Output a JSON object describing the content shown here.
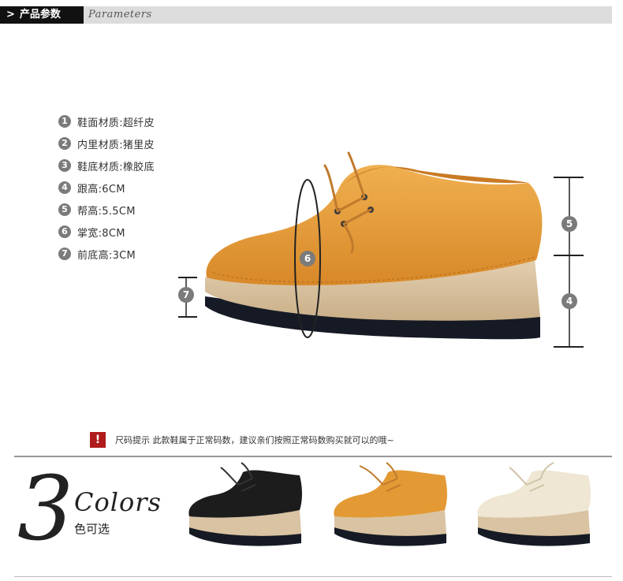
{
  "header": {
    "chevron": ">",
    "title_cn": "产品参数",
    "title_en": "Parameters"
  },
  "specs": [
    {
      "num": "1",
      "text": "鞋面材质:超纤皮"
    },
    {
      "num": "2",
      "text": "内里材质:猪里皮"
    },
    {
      "num": "3",
      "text": "鞋底材质:橡胶底"
    },
    {
      "num": "4",
      "text": "跟高:6CM"
    },
    {
      "num": "5",
      "text": "帮高:5.5CM"
    },
    {
      "num": "6",
      "text": "掌宽:8CM"
    },
    {
      "num": "7",
      "text": "前底高:3CM"
    }
  ],
  "diagram_markers": {
    "m4": "4",
    "m5": "5",
    "m6": "6",
    "m7": "7"
  },
  "notice": {
    "icon": "!",
    "text": "尺码提示 此款鞋属于正常码数，建议亲们按照正常码数购买就可以的哦~"
  },
  "colors_section": {
    "big_number": "3",
    "title_en": "Colors",
    "subtitle_cn": "色可选"
  },
  "palette": {
    "orange_upper": "#E39A35",
    "black_upper": "#1c1c1c",
    "cream_upper": "#EFE7D3",
    "platform_tan": "#D9C3A2",
    "outsole": "#161a24",
    "marker_gray": "#7b7b7b",
    "notice_red": "#b01c1c"
  }
}
